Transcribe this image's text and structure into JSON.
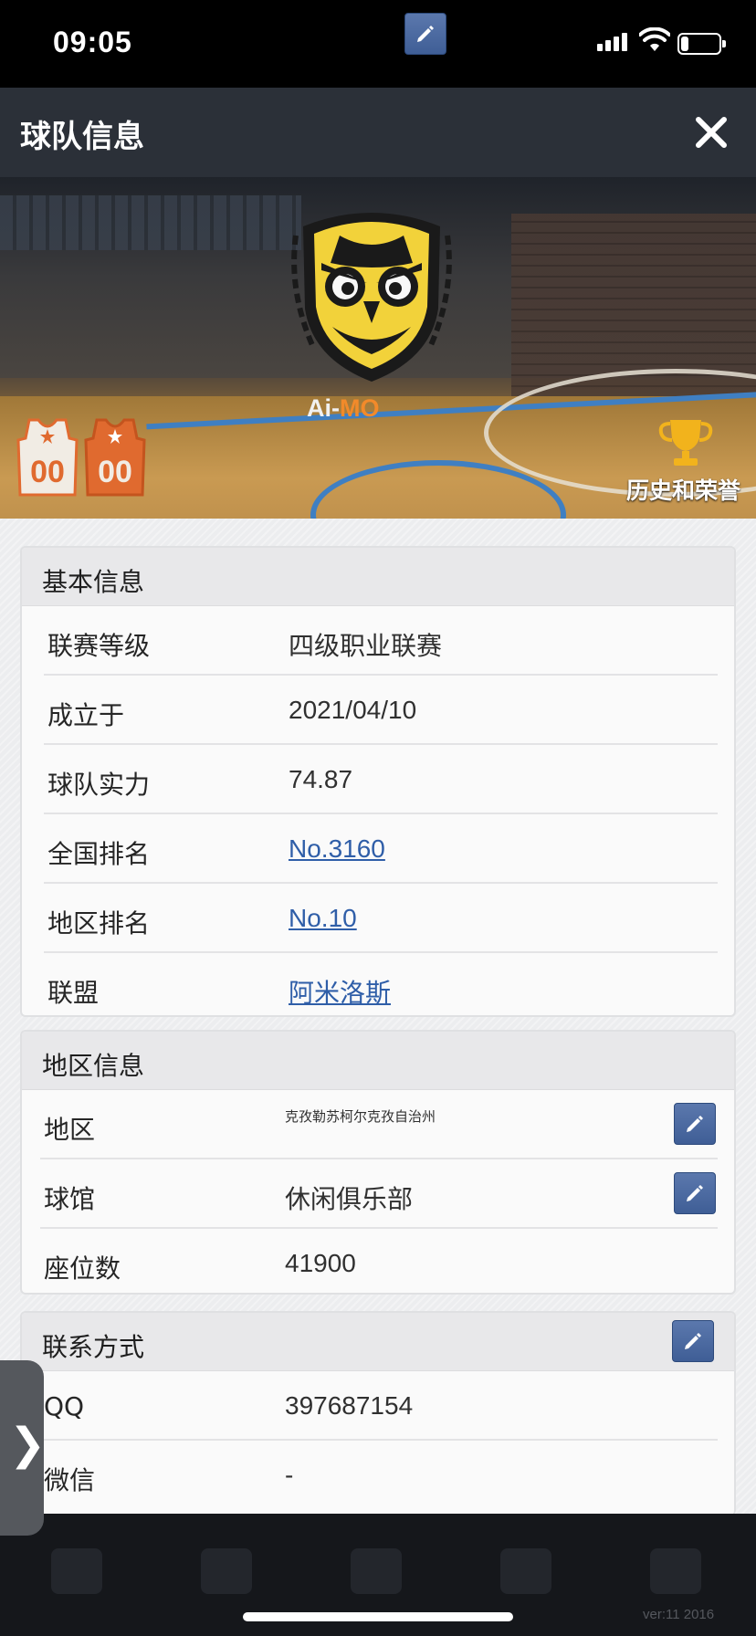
{
  "status_bar": {
    "time": "09:05",
    "battery_level": 0.2
  },
  "header": {
    "title": "球队信息",
    "close_icon": "close-icon"
  },
  "hero": {
    "team_name_prefix": "Ai-",
    "team_name_highlight": "MO",
    "honors_label": "历史和荣誉",
    "jersey_home_number": "00",
    "jersey_away_number": "00",
    "colors": {
      "logo_yellow": "#f2d23a",
      "logo_black": "#1a1a1a",
      "name_highlight": "#f28a2a"
    }
  },
  "basic_info": {
    "title": "基本信息",
    "rows": [
      {
        "label": "联赛等级",
        "value": "四级职业联赛"
      },
      {
        "label": "成立于",
        "value": "2021/04/10"
      },
      {
        "label": "球队实力",
        "value": "74.87"
      },
      {
        "label": "全国排名",
        "value": "No.3160"
      },
      {
        "label": "地区排名",
        "value": "No.10"
      },
      {
        "label": "联盟",
        "value": "阿米洛斯"
      }
    ]
  },
  "region_info": {
    "title": "地区信息",
    "rows": [
      {
        "label": "地区",
        "value": "克孜勒苏柯尔克孜自治州"
      },
      {
        "label": "球馆",
        "value": "休闲俱乐部"
      },
      {
        "label": "座位数",
        "value": "41900"
      }
    ]
  },
  "contact_info": {
    "title": "联系方式",
    "rows": [
      {
        "label": "QQ",
        "value": "397687154"
      },
      {
        "label": "微信",
        "value": "-"
      }
    ]
  },
  "side_handle": {
    "glyph": "❯"
  },
  "footer": {
    "version": "ver:11  2016"
  },
  "colors": {
    "title_bar": "#2b3038",
    "link": "#2f5ea8",
    "edit_button": "#4a6aa1"
  }
}
